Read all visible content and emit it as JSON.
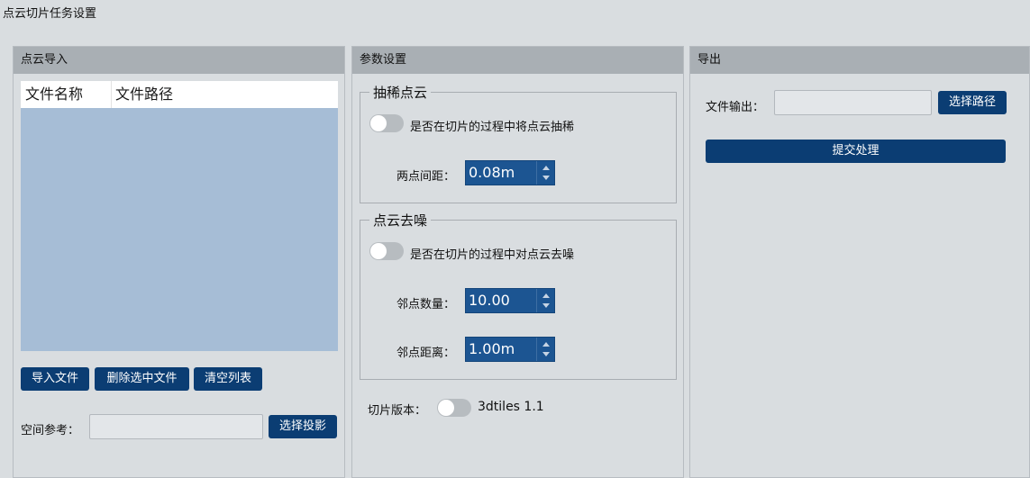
{
  "window": {
    "title": "点云切片任务设置"
  },
  "import_panel": {
    "title": "点云导入",
    "columns": [
      "文件名称",
      "文件路径"
    ],
    "buttons": {
      "import": "导入文件",
      "delete": "删除选中文件",
      "clear": "清空列表"
    },
    "crs_label": "空间参考：",
    "crs_value": "",
    "crs_button": "选择投影"
  },
  "params_panel": {
    "title": "参数设置",
    "thin": {
      "title": "抽稀点云",
      "toggle_label": "是否在切片的过程中将点云抽稀",
      "enabled": false,
      "spacing_label": "两点间距：",
      "spacing_value": "0.08m"
    },
    "denoise": {
      "title": "点云去噪",
      "toggle_label": "是否在切片的过程中对点云去噪",
      "enabled": false,
      "neighbors_label": "邻点数量：",
      "neighbors_value": "10.00",
      "distance_label": "邻点距离：",
      "distance_value": "1.00m"
    },
    "version": {
      "label": "切片版本：",
      "enabled": false,
      "toggle_label": "3dtiles 1.1"
    }
  },
  "export_panel": {
    "title": "导出",
    "output_label": "文件输出：",
    "output_value": "",
    "path_button": "选择路径",
    "submit_button": "提交处理"
  },
  "colors": {
    "button": "#0b3d73",
    "spinbox": "#1c5592",
    "header": "#a9afb4",
    "table_body": "#a6bdd6",
    "background": "#d9dde0"
  }
}
